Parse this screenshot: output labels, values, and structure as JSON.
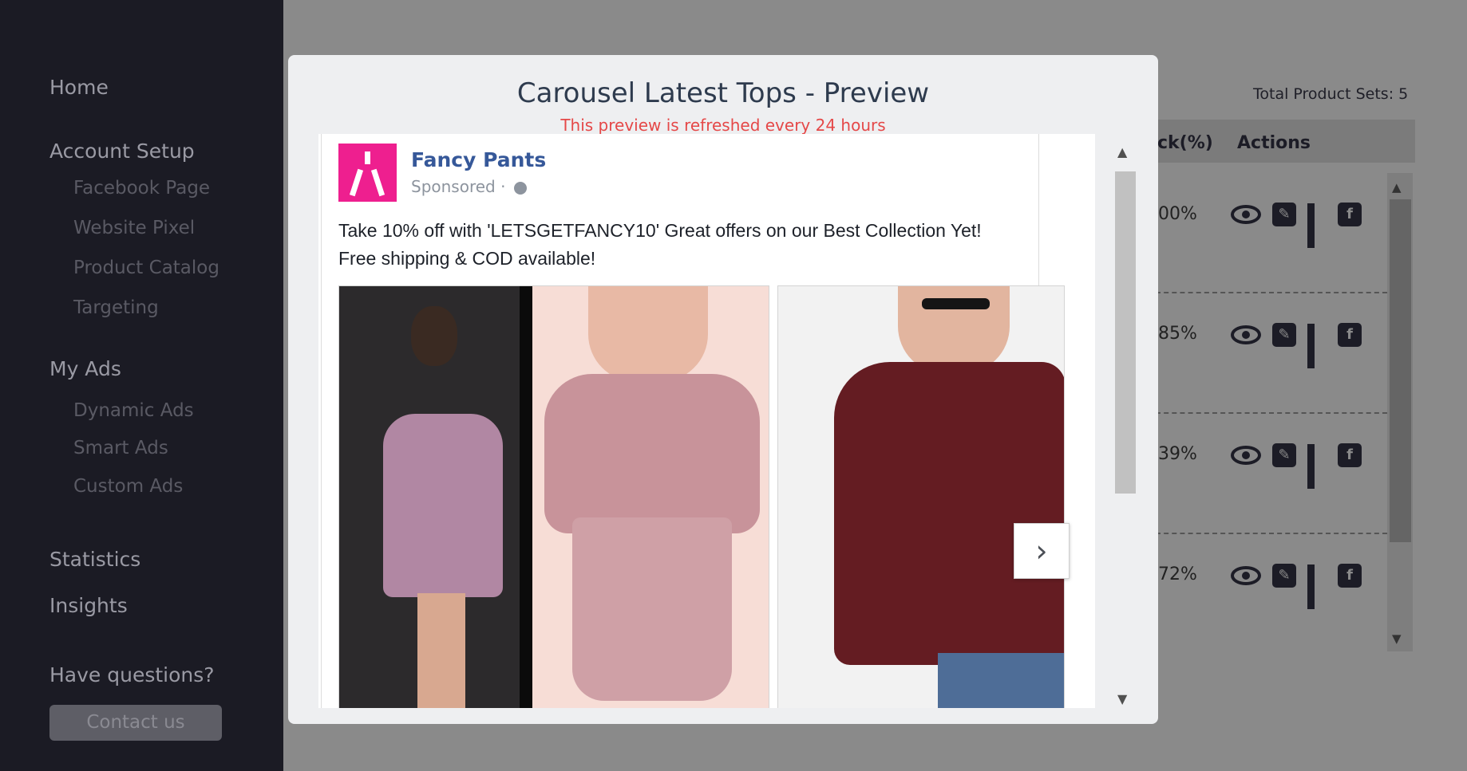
{
  "sidebar": {
    "home": "Home",
    "account_setup": "Account Setup",
    "account_items": [
      "Facebook Page",
      "Website Pixel",
      "Product Catalog",
      "Targeting"
    ],
    "my_ads": "My Ads",
    "ads_items": [
      "Dynamic Ads",
      "Smart Ads",
      "Custom Ads"
    ],
    "statistics": "Statistics",
    "insights": "Insights",
    "questions": "Have questions?",
    "contact": "Contact us"
  },
  "background": {
    "total_sets": "Total Product Sets: 5",
    "col_pct": "ck(%)",
    "col_actions": "Actions",
    "rows": [
      {
        "pct": "00%"
      },
      {
        "pct": "85%"
      },
      {
        "pct": "39%"
      },
      {
        "pct": "72%"
      }
    ],
    "scroll_up": "▲",
    "scroll_down": "▼"
  },
  "modal": {
    "title": "Carousel Latest Tops - Preview",
    "note": "This preview is refreshed every 24 hours",
    "scroll_up": "▲",
    "scroll_down": "▼"
  },
  "ad": {
    "page_name": "Fancy Pants",
    "sponsored": "Sponsored ·",
    "text": "Take 10% off with 'LETSGETFANCY10' Great offers on our Best Collection Yet! Free shipping & COD available!",
    "next": "›"
  },
  "colors": {
    "sidebar_bg": "#1b1b24",
    "brand_pink": "#ee1f8f",
    "page_name": "#365899",
    "note_red": "#e54848"
  }
}
